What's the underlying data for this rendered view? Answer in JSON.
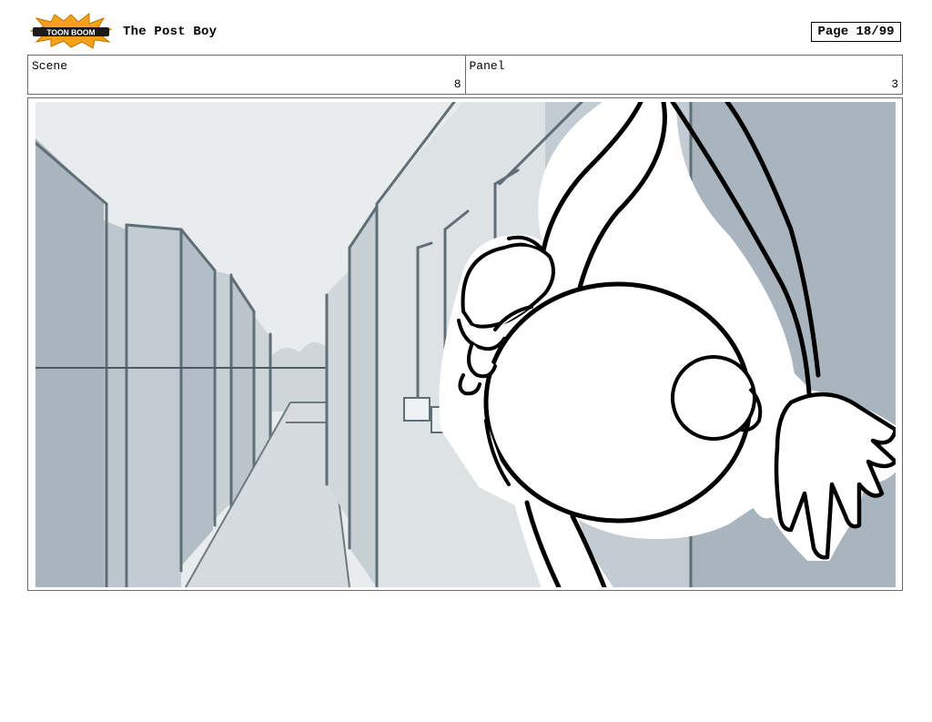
{
  "header": {
    "logo_text": "TOON BOOM",
    "title": "The Post Boy",
    "page": "Page 18/99"
  },
  "info": {
    "scene_label": "Scene",
    "scene_value": "8",
    "panel_label": "Panel",
    "panel_value": "3"
  },
  "colors": {
    "logo_burst": "#f5a21b",
    "sky": "#e9ecec",
    "wall_light": "#dde2e5",
    "wall_mid": "#c3ccd2",
    "wall_dark": "#a9b5be",
    "floor": "#d5dbde",
    "ink": "#000000"
  }
}
